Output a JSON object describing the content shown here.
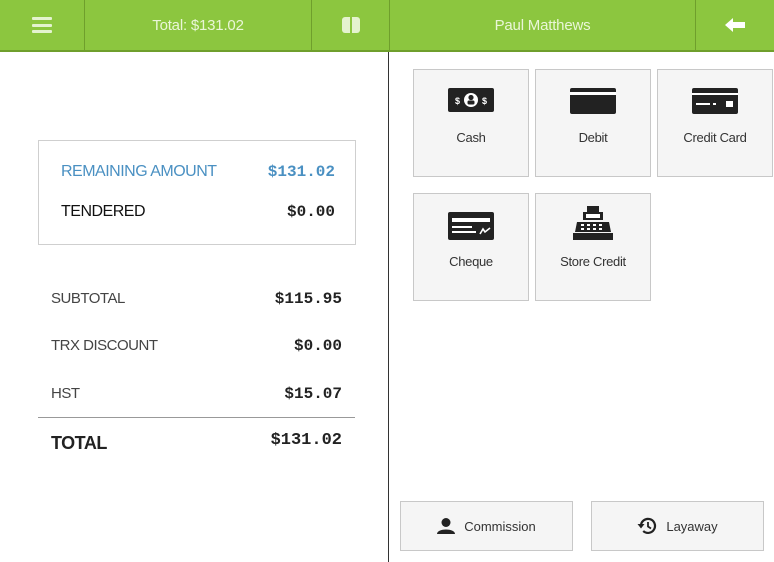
{
  "header": {
    "total_text": "Total: $131.02",
    "customer_name": "Paul Matthews",
    "menu_icon": "hamburger-icon",
    "drawer_icon": "cash-drawer-icon",
    "back_icon": "arrow-left-icon",
    "bar_color": "#8cc63f"
  },
  "amounts": {
    "remaining_label": "REMAINING AMOUNT",
    "remaining_value": "$131.02",
    "tendered_label": "TENDERED",
    "tendered_value": "$0.00",
    "accent_color": "#4a90c2"
  },
  "summary": {
    "subtotal_label": "SUBTOTAL",
    "subtotal_value": "$115.95",
    "discount_label": "TRX DISCOUNT",
    "discount_value": "$0.00",
    "tax_label": "HST",
    "tax_value": "$15.07",
    "total_label": "TOTAL",
    "total_value": "$131.02"
  },
  "tenders": [
    {
      "label": "Cash",
      "icon": "cash-icon"
    },
    {
      "label": "Debit",
      "icon": "debit-card-icon"
    },
    {
      "label": "Credit Card",
      "icon": "credit-card-icon"
    },
    {
      "label": "Cheque",
      "icon": "cheque-icon"
    },
    {
      "label": "Store Credit",
      "icon": "cash-register-icon"
    }
  ],
  "actions": {
    "commission_label": "Commission",
    "commission_icon": "user-icon",
    "layaway_label": "Layaway",
    "layaway_icon": "history-icon"
  }
}
